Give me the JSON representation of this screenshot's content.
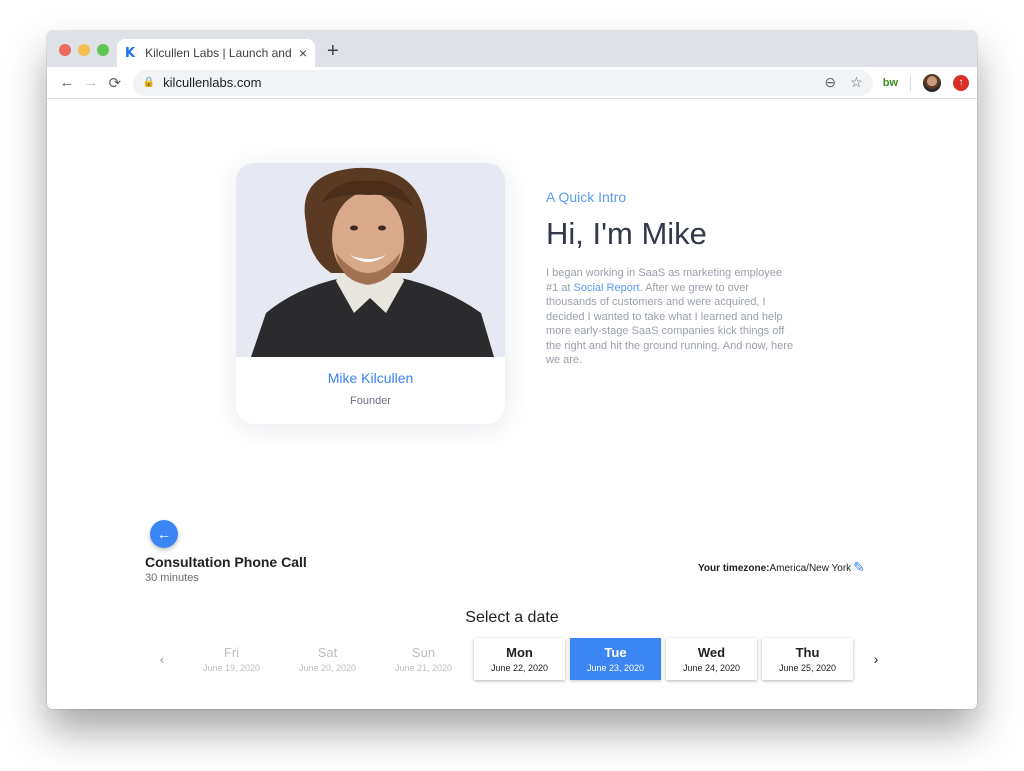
{
  "browser": {
    "tab": {
      "favicon": "K",
      "title": "Kilcullen Labs | Launch and Gro",
      "close_icon": "×"
    },
    "new_tab_icon": "+",
    "nav": {
      "back_icon": "←",
      "forward_icon": "→",
      "reload_icon": "C"
    },
    "address": {
      "lock_icon": "🔒",
      "url": "kilcullenlabs.com",
      "zoom_icon": "⊖",
      "bookmark_icon": "☆"
    },
    "extensions": {
      "bw_label": "bw",
      "update_icon": "↑"
    }
  },
  "profile_card": {
    "name": "Mike Kilcullen",
    "role": "Founder"
  },
  "intro": {
    "eyebrow": "A Quick Intro",
    "heading": "Hi, I'm Mike",
    "body_before_link": "I began working in SaaS as marketing employee #1 at ",
    "link_text": "Social Report",
    "body_after_link": ". After we grew to over thousands of customers and were acquired, I decided I wanted to take what I learned and help more early-stage SaaS companies kick things off the right and hit the ground running. And now, here we are."
  },
  "scheduler": {
    "back_icon": "←",
    "event_title": "Consultation Phone Call",
    "event_duration": "30 minutes",
    "timezone_label": "Your timezone:",
    "timezone_value": "America/New York",
    "edit_icon": "✎",
    "select_label": "Select a date",
    "prev_icon": "‹",
    "next_icon": "›",
    "days": [
      {
        "name": "Fri",
        "date": "June 19, 2020",
        "state": "disabled"
      },
      {
        "name": "Sat",
        "date": "June 20, 2020",
        "state": "disabled"
      },
      {
        "name": "Sun",
        "date": "June 21, 2020",
        "state": "disabled"
      },
      {
        "name": "Mon",
        "date": "June 22, 2020",
        "state": "available"
      },
      {
        "name": "Tue",
        "date": "June 23, 2020",
        "state": "selected"
      },
      {
        "name": "Wed",
        "date": "June 24, 2020",
        "state": "available"
      },
      {
        "name": "Thu",
        "date": "June 25, 2020",
        "state": "available"
      }
    ]
  },
  "colors": {
    "accent": "#3b86f3",
    "link": "#5a9bf0",
    "heading": "#33394a"
  }
}
